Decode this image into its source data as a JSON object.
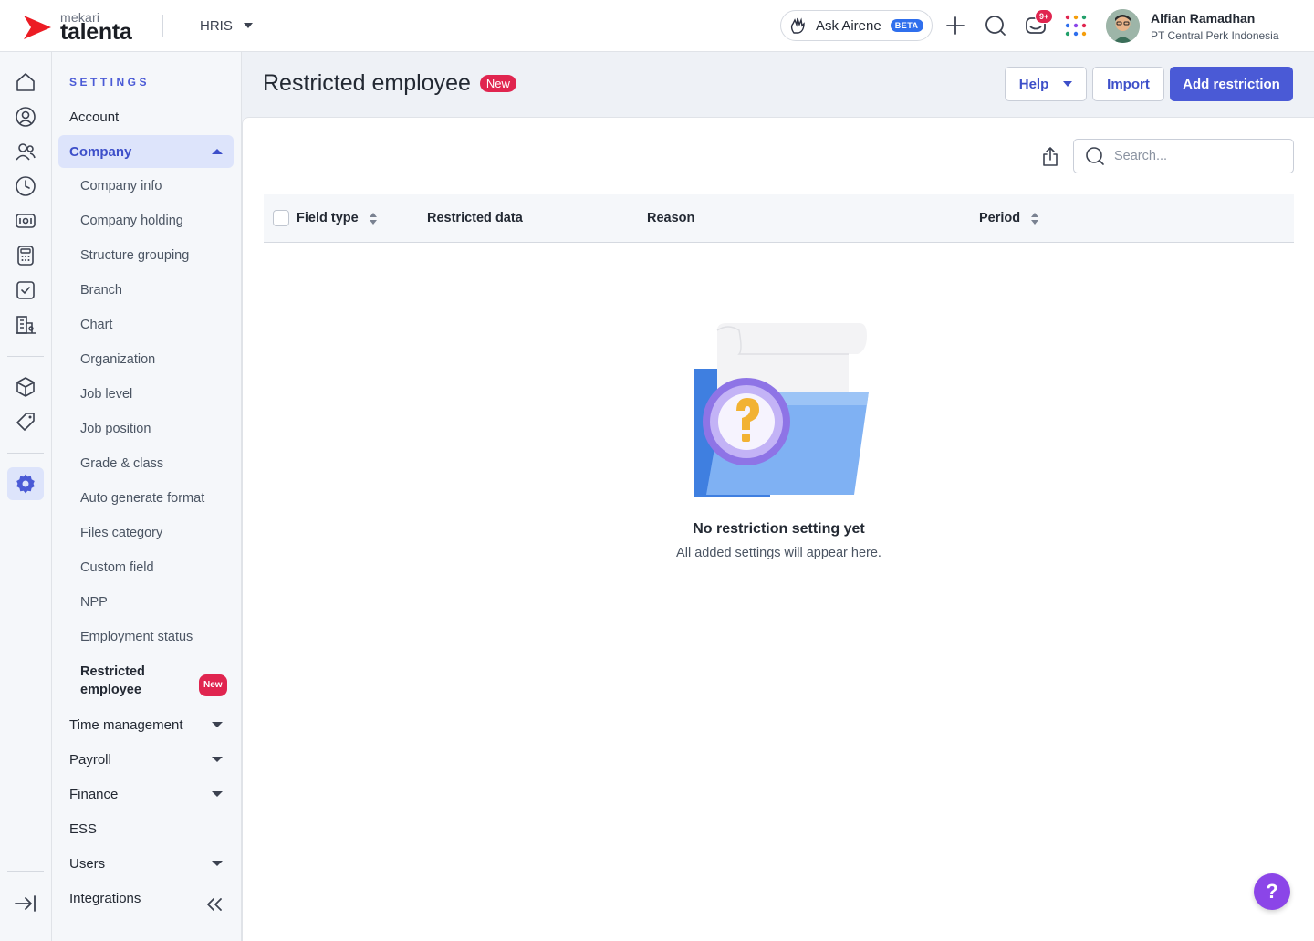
{
  "header": {
    "brand_small": "mekari",
    "brand_large": "talenta",
    "module": "HRIS",
    "ask_label": "Ask Airene",
    "ask_badge": "BETA",
    "notification_count": "9+",
    "user_name": "Alfian Ramadhan",
    "user_company": "PT Central Perk Indonesia"
  },
  "rail": {
    "icons": [
      "home-icon",
      "user-icon",
      "people-icon",
      "clock-icon",
      "money-icon",
      "calculator-icon",
      "task-icon",
      "building-icon",
      "cube-icon",
      "tag-icon",
      "gear-icon",
      "expand-icon"
    ]
  },
  "sidebar": {
    "title": "SETTINGS",
    "account": "Account",
    "company": "Company",
    "company_items": [
      "Company info",
      "Company holding",
      "Structure grouping",
      "Branch",
      "Chart",
      "Organization",
      "Job level",
      "Job position",
      "Grade & class",
      "Auto generate format",
      "Files category",
      "Custom field",
      "NPP",
      "Employment status"
    ],
    "current_item": "Restricted employee",
    "current_badge": "New",
    "sections": [
      {
        "label": "Time management",
        "expandable": true
      },
      {
        "label": "Payroll",
        "expandable": true
      },
      {
        "label": "Finance",
        "expandable": true
      },
      {
        "label": "ESS",
        "expandable": false
      },
      {
        "label": "Users",
        "expandable": true
      },
      {
        "label": "Integrations",
        "expandable": false
      }
    ]
  },
  "page": {
    "title": "Restricted employee",
    "title_badge": "New",
    "help_button": "Help",
    "import_button": "Import",
    "add_button": "Add restriction",
    "search_placeholder": "Search...",
    "columns": [
      "Field type",
      "Restricted data",
      "Reason",
      "Period"
    ],
    "empty_title": "No restriction setting yet",
    "empty_subtitle": "All added settings will appear here."
  },
  "colors": {
    "primary": "#4a5ad6",
    "badge_red": "#e0254f",
    "active_bg": "#dde4fb",
    "help_fab": "#8b45e8"
  },
  "help_fab": "?"
}
